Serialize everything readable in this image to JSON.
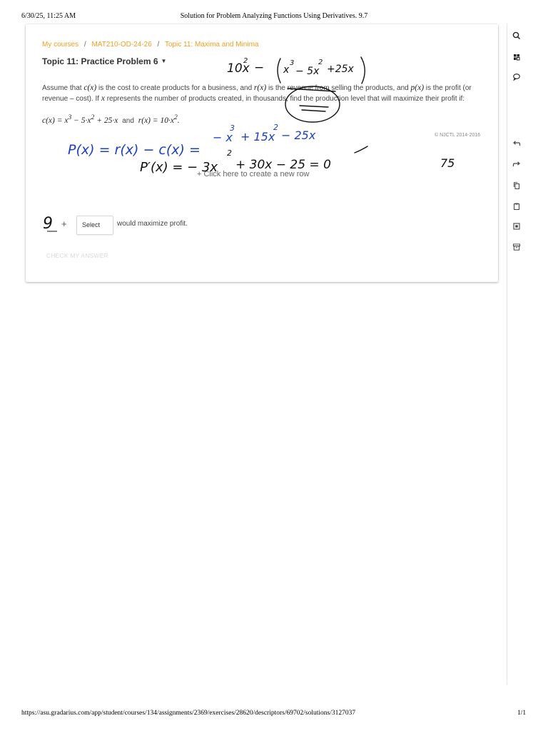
{
  "print_header": {
    "datetime": "6/30/25, 11:25 AM",
    "title": "Solution for Problem Analyzing Functions Using Derivatives. 9.7"
  },
  "breadcrumb": {
    "items": [
      "My courses",
      "MAT210-OD-24-26",
      "Topic 11: Maxima and Minima"
    ],
    "separator": "/"
  },
  "topic_title": "Topic 11: Practice Problem 6",
  "problem": {
    "p1": "Assume that ",
    "cx": "c(x)",
    "p2": " is the cost to create products for a business, and ",
    "rx": "r(x)",
    "p3": " is the revenue from selling the products, and ",
    "px": "p(x)",
    "p4": " is the profit (or revenue – cost). If ",
    "x": "x",
    "p5": " represents the number of products created, in thousands, find the production level that will maximize their profit if:"
  },
  "formula": {
    "c": "c(x) = x",
    "c_exp": "3",
    "c_mid": " − 5·x",
    "c_exp2": "2",
    "c_end": " + 25·x",
    "and": "and",
    "r": "r(x) = 10·x",
    "r_exp": "2",
    "r_end": "."
  },
  "copyright": "© NJCTL 2014-2016",
  "new_row_label": "+  Click here to create a new row",
  "answer": {
    "plus": "+",
    "select_label": "Select",
    "after_text": "would maximize profit."
  },
  "check_button": "CHECK MY ANSWER",
  "print_footer": {
    "url": "https://asu.gradarius.com/app/student/courses/134/assignments/2369/exercises/28620/descriptors/69702/solutions/3127037",
    "page": "1/1"
  },
  "handwriting": {
    "top_line": "10x² − (x³ − 5x² + 25x)",
    "blue_line": "P(x) = r(x) − c(x) = −x³ + 15x² − 25x",
    "deriv_line": "P′(x) = −3x² + 30x − 25 = 0",
    "side_number": "75",
    "answer_digit": "9",
    "ink_black": "#111111",
    "ink_blue": "#1a3fd0"
  },
  "colors": {
    "link": "#f0a01e",
    "check_disabled": "#d9d9d9"
  },
  "sidebar_icons": [
    "search-icon",
    "grid-icon",
    "comment-icon",
    "undo-icon",
    "redo-icon",
    "copy-icon",
    "paste-icon",
    "screenshot-icon",
    "archive-icon"
  ]
}
